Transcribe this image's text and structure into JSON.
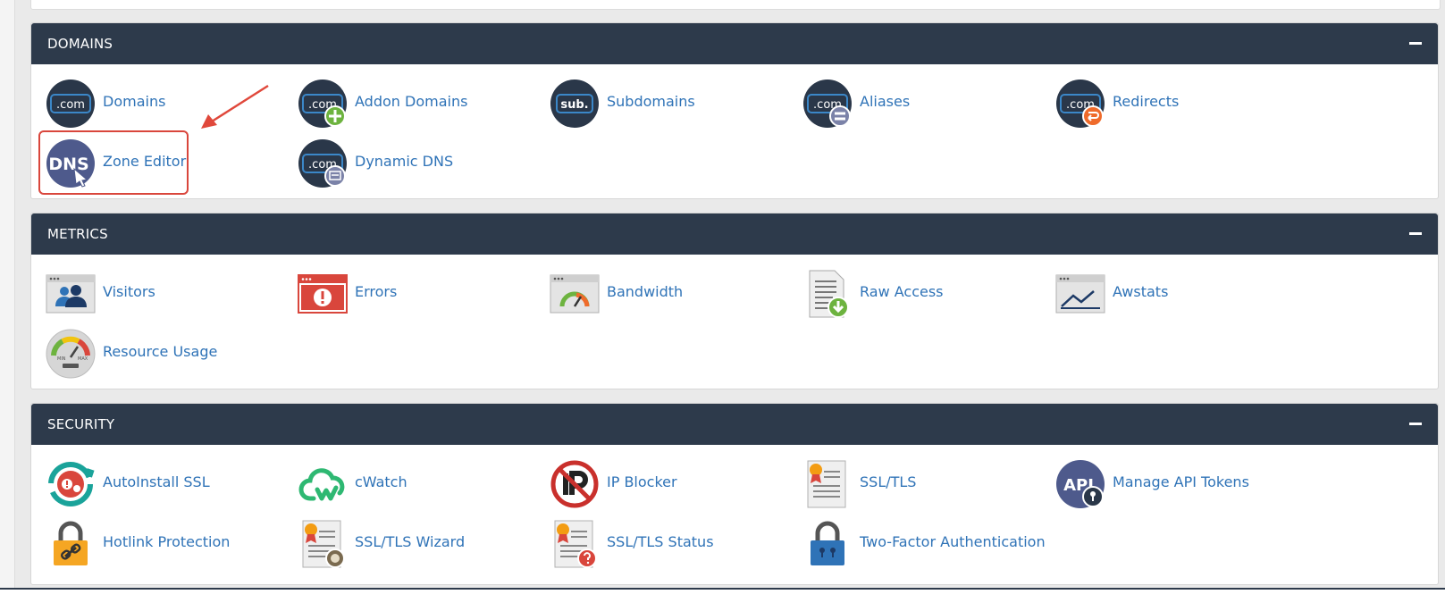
{
  "sections": [
    {
      "title": "DOMAINS",
      "items": [
        {
          "label": "Domains",
          "icon": "dotcom-icon"
        },
        {
          "label": "Addon Domains",
          "icon": "dotcom-add-icon"
        },
        {
          "label": "Subdomains",
          "icon": "sub-icon"
        },
        {
          "label": "Aliases",
          "icon": "dotcom-alias-icon"
        },
        {
          "label": "Redirects",
          "icon": "dotcom-redirect-icon"
        },
        {
          "label": "Zone Editor",
          "icon": "dns-icon"
        },
        {
          "label": "Dynamic DNS",
          "icon": "dotcom-dynamic-icon"
        }
      ]
    },
    {
      "title": "METRICS",
      "items": [
        {
          "label": "Visitors",
          "icon": "visitors-icon"
        },
        {
          "label": "Errors",
          "icon": "errors-icon"
        },
        {
          "label": "Bandwidth",
          "icon": "bandwidth-gauge-icon"
        },
        {
          "label": "Raw Access",
          "icon": "raw-access-document-icon"
        },
        {
          "label": "Awstats",
          "icon": "awstats-chart-icon"
        },
        {
          "label": "Resource Usage",
          "icon": "resource-usage-gauge-icon"
        }
      ]
    },
    {
      "title": "SECURITY",
      "items": [
        {
          "label": "AutoInstall SSL",
          "icon": "autoinstall-ssl-icon"
        },
        {
          "label": "cWatch",
          "icon": "cwatch-cloud-icon"
        },
        {
          "label": "IP Blocker",
          "icon": "ip-blocker-icon"
        },
        {
          "label": "SSL/TLS",
          "icon": "certificate-icon"
        },
        {
          "label": "Manage API Tokens",
          "icon": "api-key-icon"
        },
        {
          "label": "Hotlink Protection",
          "icon": "padlock-link-icon"
        },
        {
          "label": "SSL/TLS Wizard",
          "icon": "certificate-wizard-icon"
        },
        {
          "label": "SSL/TLS Status",
          "icon": "certificate-status-icon"
        },
        {
          "label": "Two-Factor Authentication",
          "icon": "padlock-2fa-icon"
        }
      ]
    }
  ],
  "icon_text": {
    "com": ".com",
    "sub": "sub.",
    "dns": "DNS",
    "api": "API",
    "min": "MIN",
    "max": "MAX"
  },
  "colors": {
    "header_bg": "#2d3a4b",
    "link": "#2f73b7",
    "highlight": "#d9463c"
  }
}
